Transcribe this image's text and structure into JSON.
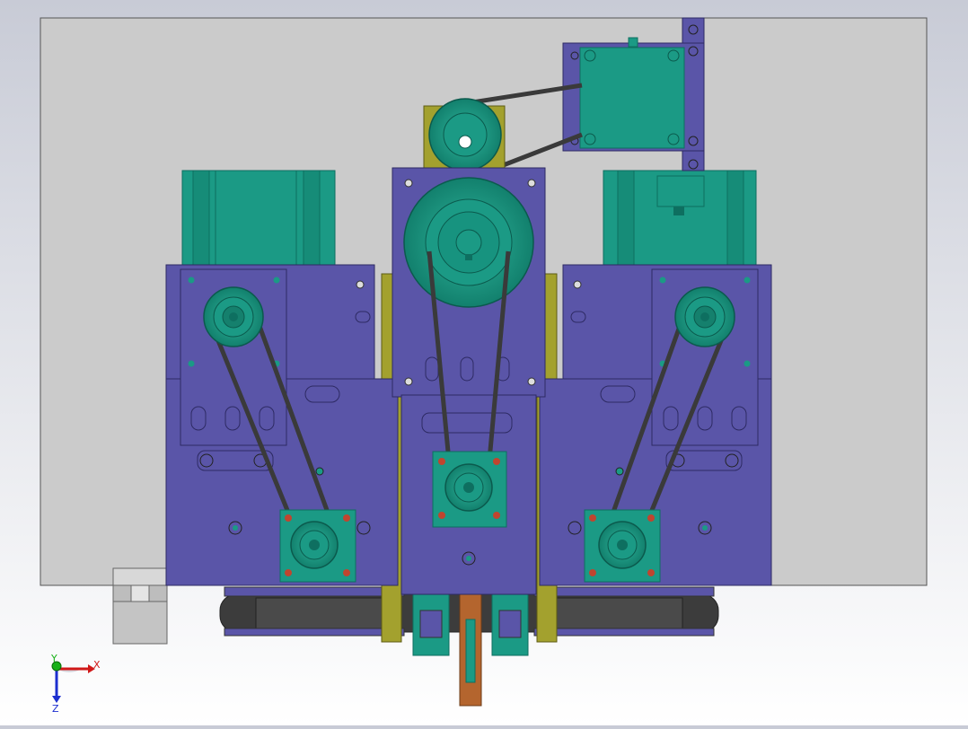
{
  "viewport": {
    "background_top": "#c8cbd6",
    "background_bottom": "#ffffff"
  },
  "colors": {
    "plate_gray": "#cbcbcb",
    "bracket_purple": "#5a55a8",
    "bracket_purple_dark": "#4a4690",
    "motor_teal": "#1b9a85",
    "motor_teal_dark": "#0e6f60",
    "olive": "#a3a12e",
    "belt": "#3a3a3a",
    "hole_red": "#c0452f",
    "rubber_dark": "#3c3c3c",
    "copper": "#b4652e"
  },
  "triad": {
    "x_label": "X",
    "y_label": "Y",
    "z_label": "Z",
    "x_color": "#d01818",
    "y_color": "#18b018",
    "z_color": "#1c2fcf"
  }
}
